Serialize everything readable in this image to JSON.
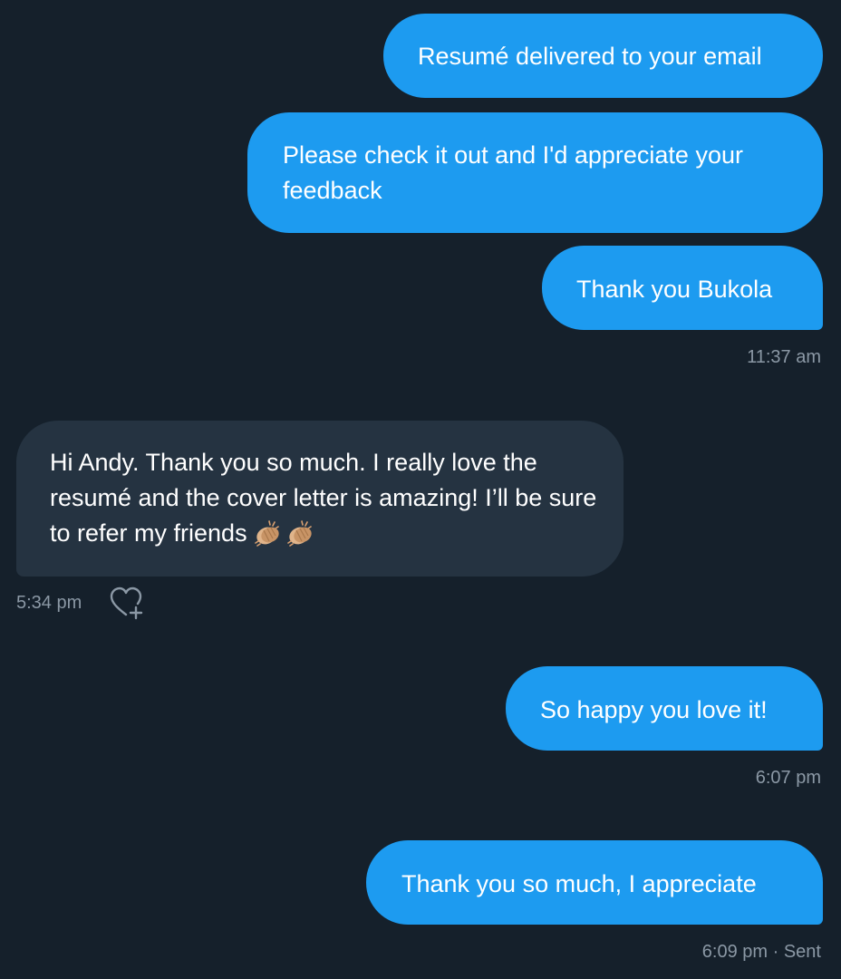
{
  "conversation": {
    "messages": [
      {
        "direction": "outgoing",
        "text": "Resumé delivered to your email"
      },
      {
        "direction": "outgoing",
        "text": "Please check it out and I'd appreciate your feedback"
      },
      {
        "direction": "outgoing",
        "text": "Thank you Bukola",
        "time": "11:37 am"
      },
      {
        "direction": "incoming",
        "text": "Hi Andy. Thank you so much. I really love the resumé and the cover letter is amazing! I’ll be sure to refer my friends",
        "emoji": [
          "clapping-hands",
          "clapping-hands"
        ],
        "time": "5:34 pm"
      },
      {
        "direction": "outgoing",
        "text": "So happy you love it!",
        "time": "6:07 pm"
      },
      {
        "direction": "outgoing",
        "text": "Thank you so much, I appreciate",
        "time": "6:09 pm",
        "status": "Sent"
      }
    ]
  },
  "ui": {
    "reaction_icon": "heart-plus-icon",
    "colors": {
      "background": "#15202b",
      "outgoing_bubble": "#1d9bf0",
      "incoming_bubble": "#253341",
      "meta_text": "#8b98a5"
    }
  }
}
